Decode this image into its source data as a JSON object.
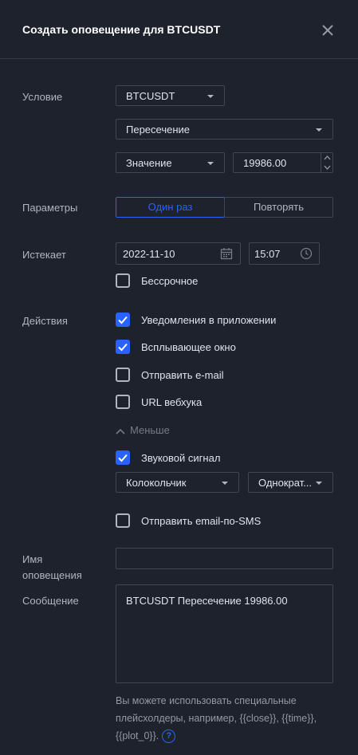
{
  "dialog": {
    "title": "Создать оповещение для BTCUSDT"
  },
  "condition": {
    "label": "Условие",
    "symbol": "BTCUSDT",
    "operator": "Пересечение",
    "value_type": "Значение",
    "value": "19986.00"
  },
  "parameters": {
    "label": "Параметры",
    "options": [
      "Один раз",
      "Повторять"
    ],
    "selected": "Один раз"
  },
  "expires": {
    "label": "Истекает",
    "date": "2022-11-10",
    "time": "15:07",
    "no_expiry_label": "Бессрочное",
    "no_expiry_checked": false
  },
  "actions": {
    "label": "Действия",
    "items": [
      {
        "label": "Уведомления в приложении",
        "checked": true
      },
      {
        "label": "Всплывающее окно",
        "checked": true
      },
      {
        "label": "Отправить e-mail",
        "checked": false
      },
      {
        "label": "URL вебхука",
        "checked": false
      }
    ],
    "less_label": "Меньше",
    "sound": {
      "label": "Звуковой сигнал",
      "checked": true,
      "sound_name": "Колокольчик",
      "repeat": "Однократ..."
    },
    "email_sms": {
      "label": "Отправить email-по-SMS",
      "checked": false
    }
  },
  "alert_name": {
    "label_line1": "Имя",
    "label_line2": "оповещения",
    "value": ""
  },
  "message": {
    "label": "Сообщение",
    "value": "BTCUSDT Пересечение 19986.00",
    "hint": "Вы можете использовать специальные плейсхолдеры, например, {{close}}, {{time}}, {{plot_0}}.",
    "help_icon": "?"
  },
  "colors": {
    "background": "#1e222d",
    "accent": "#2962ff",
    "border": "#434651",
    "text": "#d1d4dc"
  }
}
